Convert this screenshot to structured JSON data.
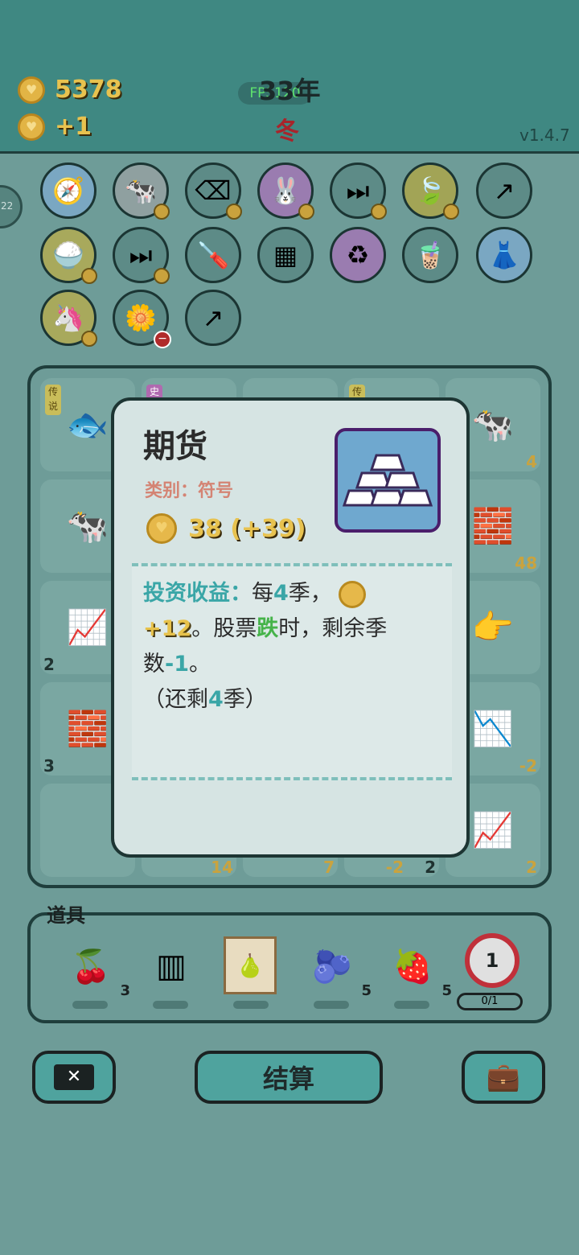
{
  "header": {
    "money": "5378",
    "income": "+1",
    "fps": "FPS120",
    "year": "33年",
    "season": "冬",
    "version": "v1.4.7",
    "side_tab": "22"
  },
  "modal": {
    "title": "期货",
    "category": "类别：符号",
    "price": "38 (+39)",
    "desc_label": "投资收益：",
    "desc_part1": "每",
    "desc_num1": "4",
    "desc_part2": "季，",
    "desc_gain": "+12",
    "desc_part3": "。股票",
    "desc_fall": "跌",
    "desc_part4": "时，剩余季数",
    "desc_minus": "-1",
    "desc_part5": "。",
    "remain_open": "（还剩",
    "remain_num": "4",
    "remain_close": "季）"
  },
  "board": {
    "counts": [
      "4",
      "48",
      "2",
      "3",
      "-2",
      "14",
      "7",
      "-2",
      "2",
      "2"
    ],
    "tags": [
      "传说",
      "史",
      "传"
    ]
  },
  "tools": {
    "label": "道具",
    "lychee_count": "3",
    "blueberry_count": "5",
    "strawberry_count": "5",
    "target_number": "1",
    "slot_text": "0/1"
  },
  "buttons": {
    "settle": "结算"
  }
}
